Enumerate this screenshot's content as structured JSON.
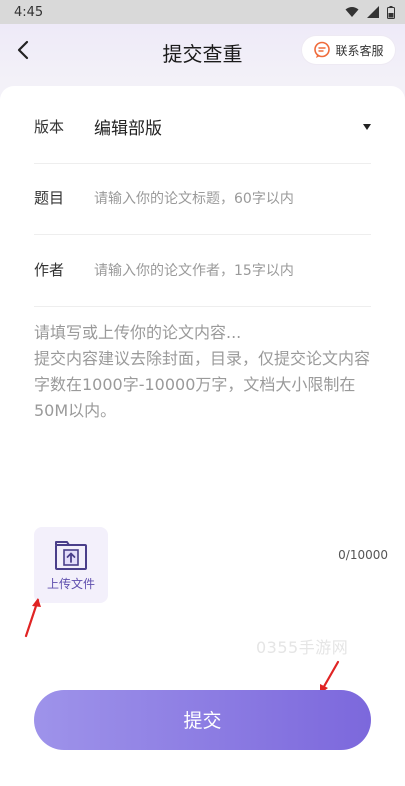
{
  "status_bar": {
    "time": "4:45",
    "icons": [
      "wifi-icon",
      "signal-icon",
      "battery-icon"
    ]
  },
  "header": {
    "title": "提交查重",
    "service_label": "联系客服"
  },
  "form": {
    "version": {
      "label": "版本",
      "value": "编辑部版"
    },
    "topic": {
      "label": "题目",
      "placeholder": "请输入你的论文标题，60字以内"
    },
    "author": {
      "label": "作者",
      "placeholder": "请输入你的论文作者，15字以内"
    },
    "content_hint": "请填写或上传你的论文内容...\n提交内容建议去除封面，目录，仅提交论文内容字数在1000字-10000万字，文档大小限制在50M以内。"
  },
  "upload": {
    "label": "上传文件"
  },
  "counter": "0/10000",
  "watermark": "0355手游网",
  "submit": {
    "label": "提交"
  },
  "colors": {
    "accent": "#7c68dc",
    "annotation_arrow": "#e02424"
  }
}
